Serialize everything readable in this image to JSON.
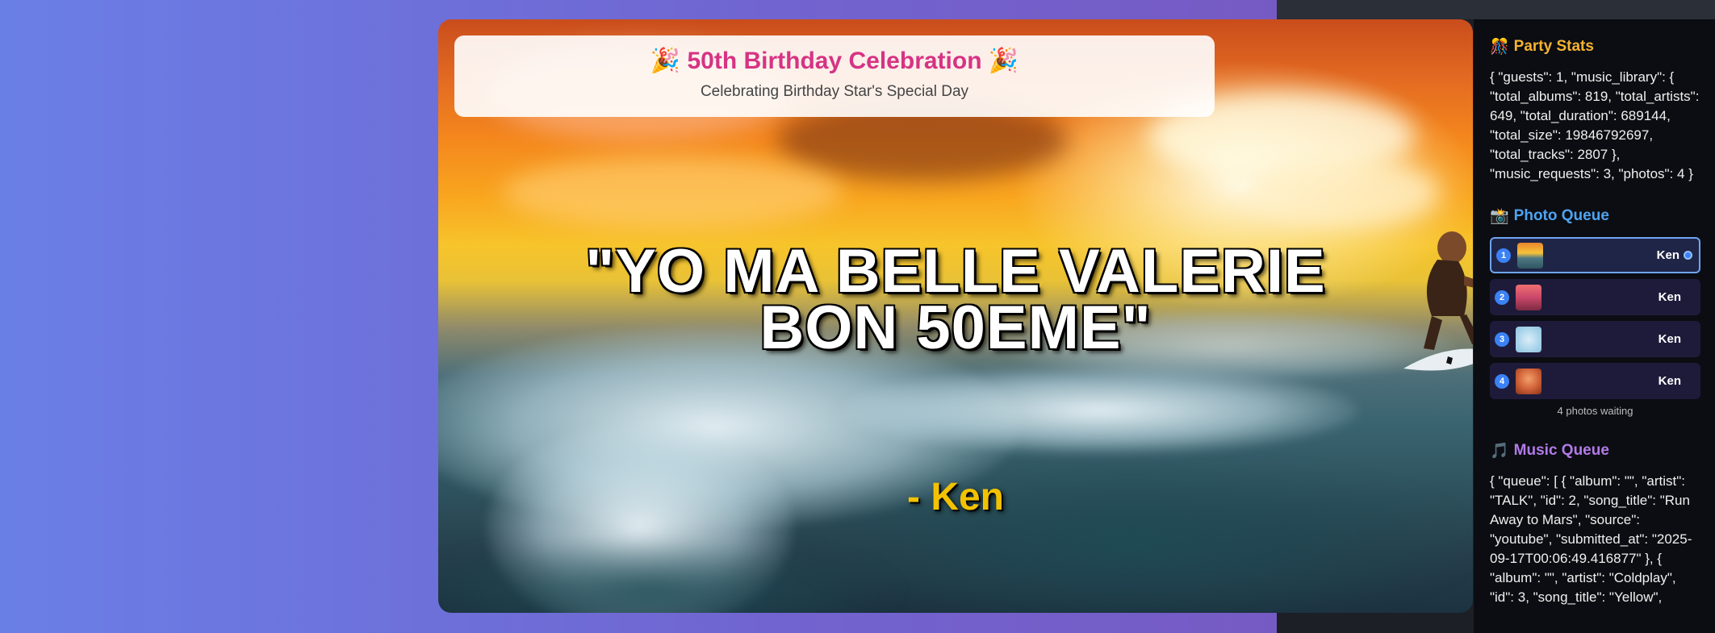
{
  "header": {
    "title": "🎉 50th Birthday Celebration 🎉",
    "subtitle": "Celebrating Birthday Star's Special Day"
  },
  "display": {
    "quote_line1": "\"YO MA BELLE VALERIE",
    "quote_line2": "BON 50EME\"",
    "author": "- Ken"
  },
  "sidebar": {
    "stats": {
      "icon": "🎊",
      "title": "Party Stats",
      "json": "{ \"guests\": 1, \"music_library\": { \"total_albums\": 819, \"total_artists\": 649, \"total_duration\": 689144, \"total_size\": 19846792697, \"total_tracks\": 2807 }, \"music_requests\": 3, \"photos\": 4 }"
    },
    "photo_queue": {
      "icon": "📸",
      "title": "Photo Queue",
      "items": [
        {
          "num": "1",
          "user": "Ken"
        },
        {
          "num": "2",
          "user": "Ken"
        },
        {
          "num": "3",
          "user": "Ken"
        },
        {
          "num": "4",
          "user": "Ken"
        }
      ],
      "waiting": "4 photos waiting"
    },
    "music_queue": {
      "icon": "🎵",
      "title": "Music Queue",
      "json": "{ \"queue\": [ { \"album\": \"\", \"artist\": \"TALK\", \"id\": 2, \"song_title\": \"Run Away to Mars\", \"source\": \"youtube\", \"submitted_at\": \"2025-09-17T00:06:49.416877\" }, { \"album\": \"\", \"artist\": \"Coldplay\", \"id\": 3, \"song_title\": \"Yellow\","
    }
  }
}
